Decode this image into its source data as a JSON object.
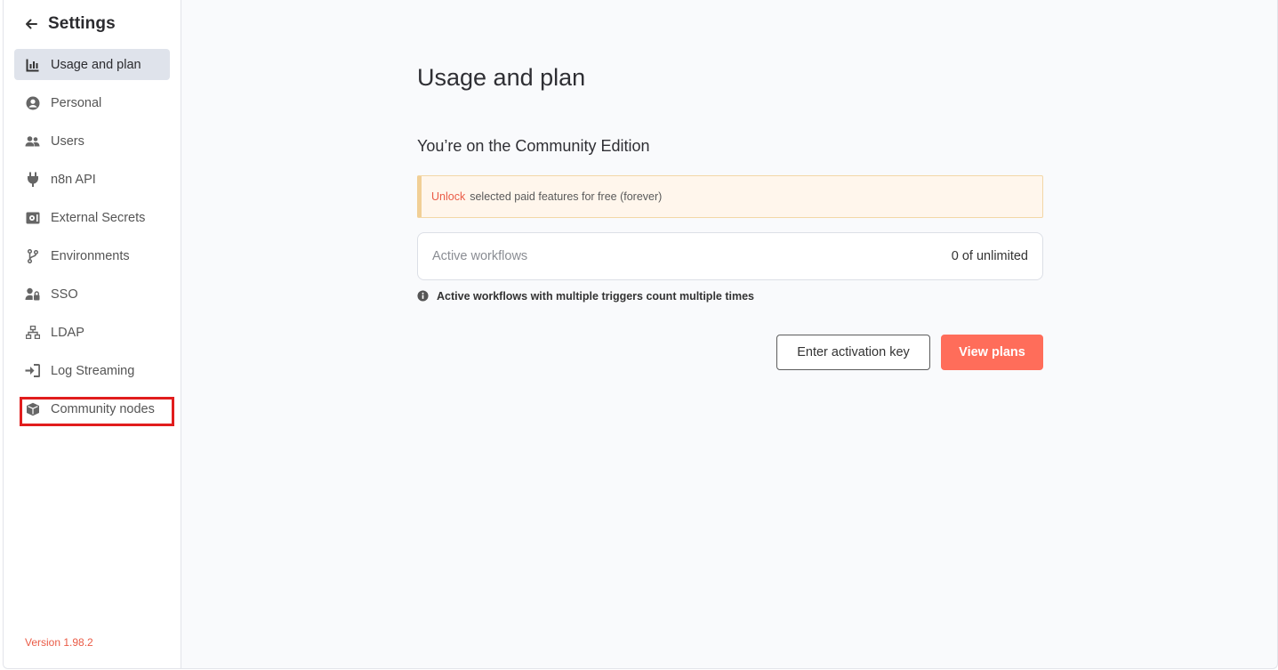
{
  "sidebar": {
    "title": "Settings",
    "back_icon": "arrow-left-icon",
    "items": [
      {
        "label": "Usage and plan",
        "icon": "chart-bar-icon",
        "active": true
      },
      {
        "label": "Personal",
        "icon": "user-circle-icon"
      },
      {
        "label": "Users",
        "icon": "user-group-icon"
      },
      {
        "label": "n8n API",
        "icon": "plug-icon"
      },
      {
        "label": "External Secrets",
        "icon": "vault-icon"
      },
      {
        "label": "Environments",
        "icon": "code-branch-icon"
      },
      {
        "label": "SSO",
        "icon": "user-lock-icon"
      },
      {
        "label": "LDAP",
        "icon": "network-wired-icon"
      },
      {
        "label": "Log Streaming",
        "icon": "sign-in-icon"
      },
      {
        "label": "Community nodes",
        "icon": "cube-icon"
      }
    ],
    "highlighted_item": "Community nodes",
    "version": "Version 1.98.2"
  },
  "main": {
    "title": "Usage and plan",
    "edition": "You’re on the Community Edition",
    "callout": {
      "link": "Unlock",
      "text": "selected paid features for free (forever)"
    },
    "usage": {
      "label": "Active workflows",
      "value": "0 of unlimited"
    },
    "note": "Active workflows with multiple triggers count multiple times",
    "buttons": {
      "activation": "Enter activation key",
      "plans": "View plans"
    }
  },
  "colors": {
    "accent": "#ff6d5a",
    "version": "#ea5b46",
    "active_bg": "#dfe3eb",
    "highlight": "#e11d1d"
  }
}
